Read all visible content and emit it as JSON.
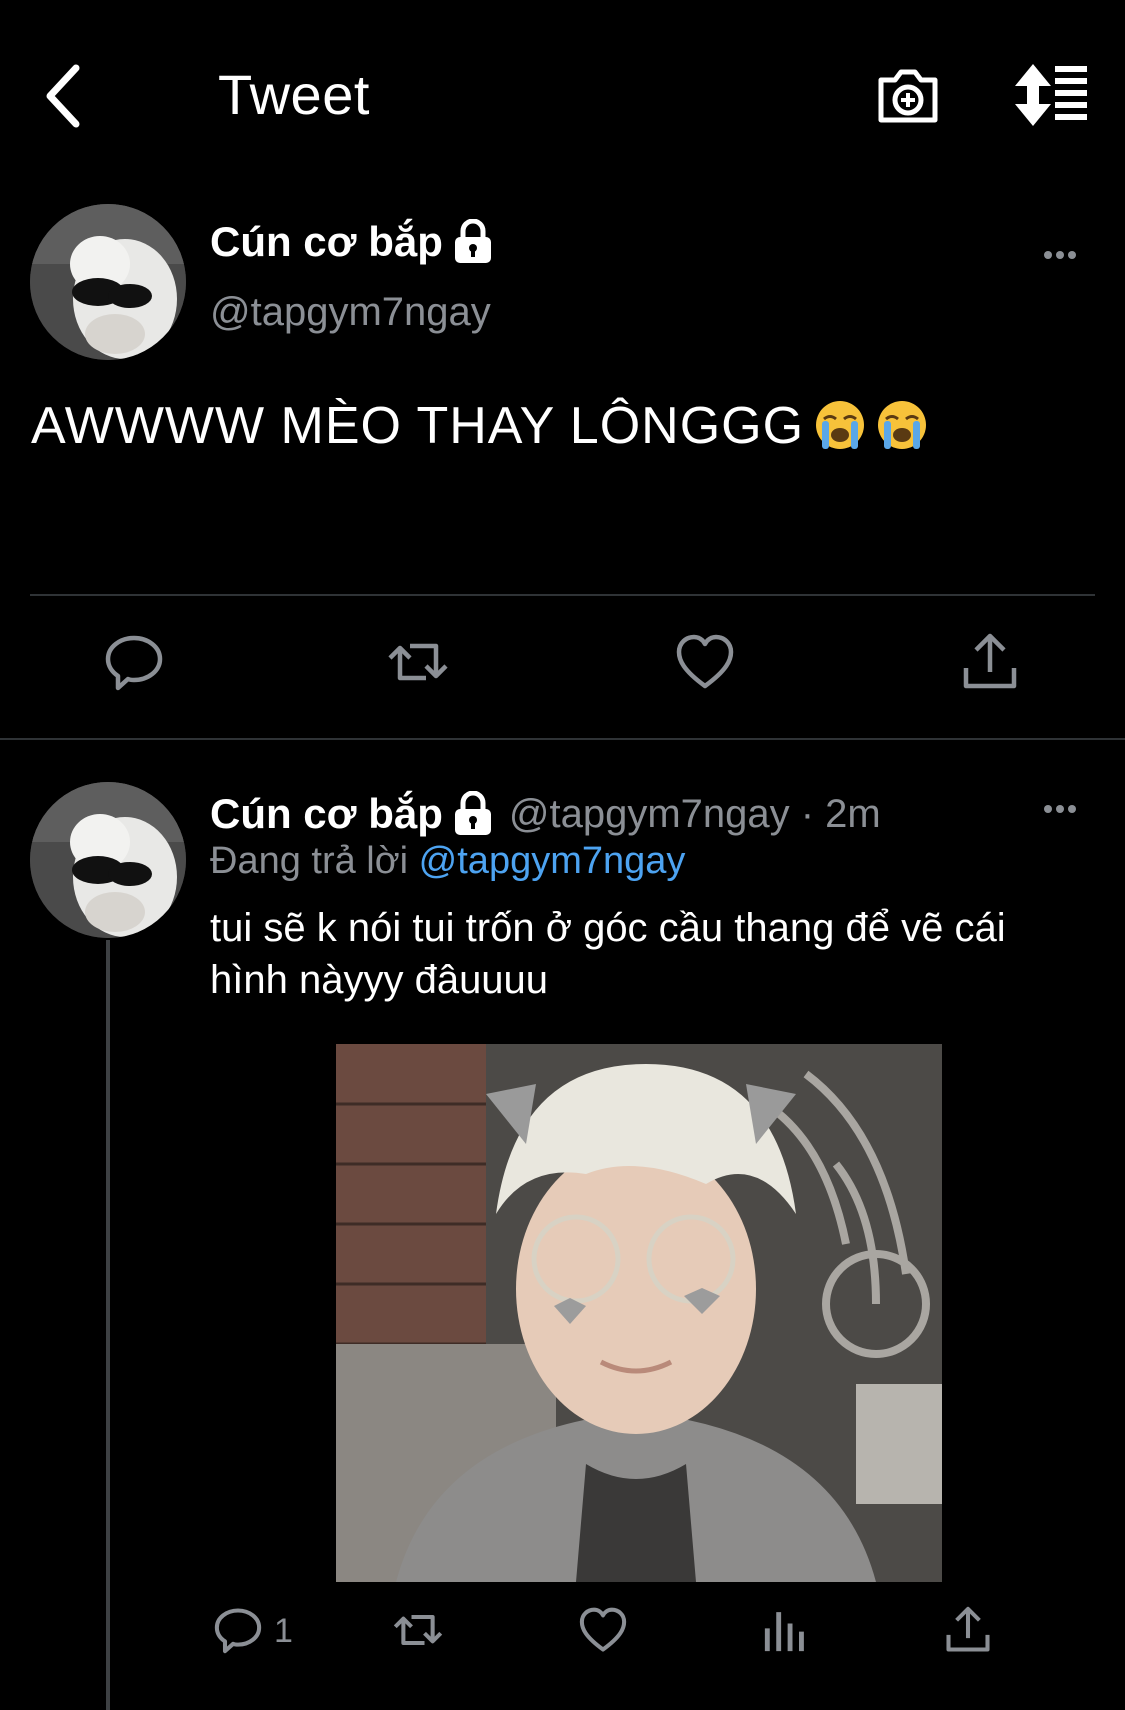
{
  "header": {
    "title": "Tweet",
    "back_icon": "chevron-left-icon",
    "camera_icon": "camera-plus-icon",
    "sort_icon": "sort-toggle-icon"
  },
  "main_tweet": {
    "display_name": "Cún cơ bắp",
    "handle": "@tapgym7ngay",
    "text": "AWWWW MÈO THAY LÔNGGG",
    "emoji": [
      "😭",
      "😭"
    ],
    "actions": [
      "reply-icon",
      "retweet-icon",
      "like-icon",
      "share-icon"
    ]
  },
  "reply_tweet": {
    "display_name": "Cún cơ bắp",
    "handle_time": "@tapgym7ngay · 2m",
    "replying_prefix": "Đang trả lời",
    "replying_to": "@tapgym7ngay",
    "text": "tui sẽ k nói tui trốn ở góc cầu thang để vẽ cái hình nàyyy đâuuuu",
    "reply_count": "1",
    "actions": [
      "reply-icon",
      "retweet-icon",
      "like-icon",
      "analytics-icon",
      "share-icon"
    ]
  },
  "colors": {
    "background": "#000000",
    "text_primary": "#ffffff",
    "text_secondary": "#8b8f95",
    "link": "#4da3f1",
    "divider": "#2f3336"
  }
}
